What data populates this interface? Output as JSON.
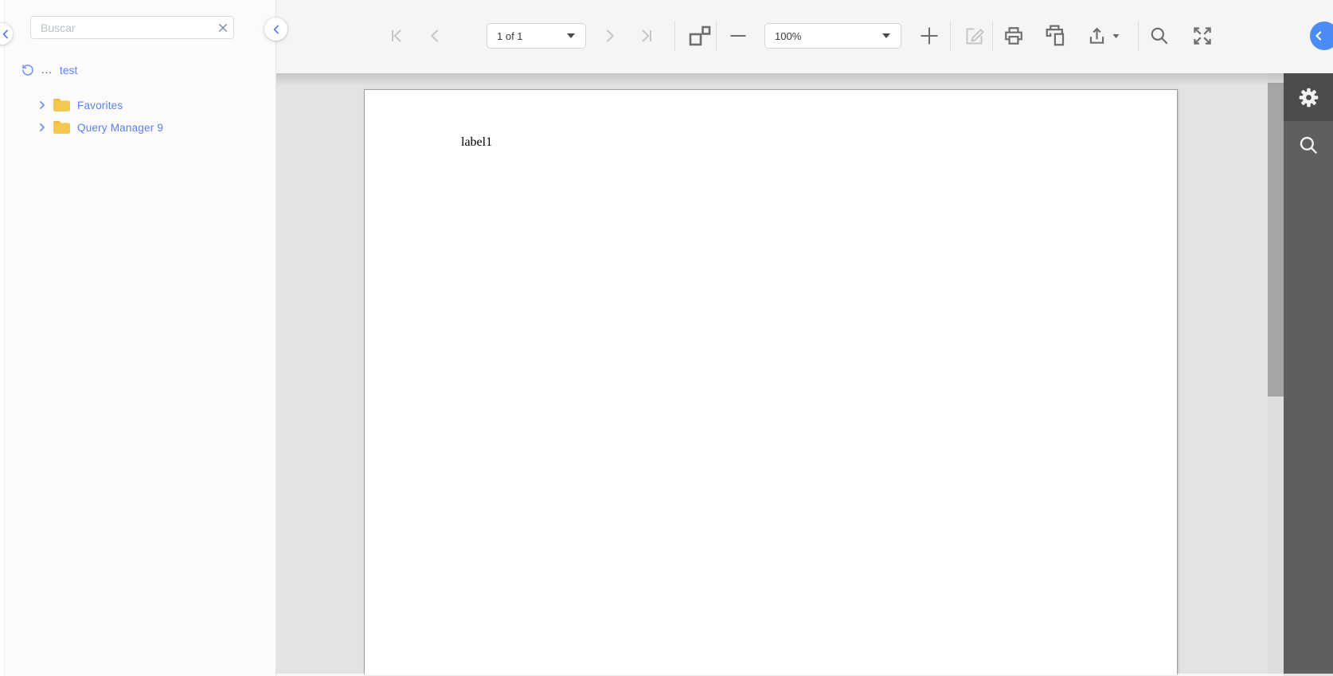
{
  "sidebar": {
    "search": {
      "placeholder": "Buscar",
      "value": ""
    },
    "breadcrumb": {
      "ellipsis": "...",
      "current": "test"
    },
    "tree": [
      {
        "label": "Favorites",
        "type": "folder",
        "expandable": true
      },
      {
        "label": "Query Manager 9",
        "type": "folder",
        "expandable": true
      }
    ]
  },
  "toolbar": {
    "page_selector": {
      "value": "1 of 1"
    },
    "zoom_selector": {
      "value": "100%"
    },
    "buttons": [
      {
        "name": "first-page",
        "disabled": true
      },
      {
        "name": "previous-page",
        "disabled": true
      },
      {
        "name": "next-page",
        "disabled": true
      },
      {
        "name": "last-page",
        "disabled": true
      },
      {
        "name": "multipage-view",
        "disabled": false
      },
      {
        "name": "zoom-out",
        "disabled": false
      },
      {
        "name": "zoom-in",
        "disabled": false
      },
      {
        "name": "edit",
        "disabled": true
      },
      {
        "name": "print",
        "disabled": false
      },
      {
        "name": "print-page",
        "disabled": false
      },
      {
        "name": "export",
        "disabled": false
      },
      {
        "name": "search",
        "disabled": false
      },
      {
        "name": "fullscreen",
        "disabled": false
      }
    ]
  },
  "document": {
    "text": "label1",
    "current_page_display": "1 of 1",
    "zoom_display": "100%"
  },
  "right_panel": {
    "tabs": [
      {
        "name": "settings"
      },
      {
        "name": "search"
      }
    ],
    "active_tab": "settings"
  },
  "icons": {
    "clear-search": "x",
    "undo": "circular-arrow-ccw",
    "tree-chevron": ">",
    "folder": "folder",
    "collapse-left": "<",
    "expand-panel": "<",
    "settings": "gear",
    "panel-search": "magnifier"
  },
  "colors": {
    "accent_blue": "#5c7df5",
    "expander_blue": "#4b8bf5",
    "folder_yellow": "#f4c74e",
    "toolbar_bg": "#f5f5f5",
    "sidebar_bg": "#fbfbfb",
    "document_bg": "#e3e3e3",
    "dark_rail": "#5f5f5f",
    "dark_rail_active": "#4c4c4c",
    "icon_gray": "#6e6e6e",
    "icon_disabled": "#c5c5c5"
  }
}
